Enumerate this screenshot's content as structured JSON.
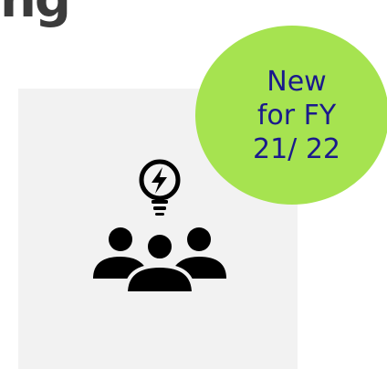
{
  "heading": {
    "partial_text": "ng"
  },
  "badge": {
    "line1": "New",
    "line2": "for FY",
    "line3": "21/ 22",
    "color": "#a6e350",
    "text_color": "#1a1a8c"
  },
  "card": {
    "background": "#f2f2f2",
    "icon": "team-idea-icon"
  }
}
